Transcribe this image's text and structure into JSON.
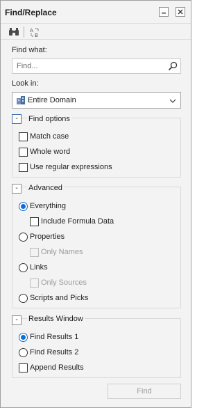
{
  "window": {
    "title": "Find/Replace"
  },
  "find_what": {
    "label": "Find what:",
    "placeholder": "Find..."
  },
  "look_in": {
    "label": "Look in:",
    "value": "Entire Domain"
  },
  "find_options": {
    "title": "Find options",
    "items": [
      {
        "label": "Match case"
      },
      {
        "label": "Whole word"
      },
      {
        "label": "Use regular expressions"
      }
    ]
  },
  "advanced": {
    "title": "Advanced",
    "everything": "Everything",
    "include_formula": "Include Formula Data",
    "properties": "Properties",
    "only_names": "Only Names",
    "links": "Links",
    "only_sources": "Only Sources",
    "scripts": "Scripts and Picks"
  },
  "results_window": {
    "title": "Results Window",
    "find_results_1": "Find Results 1",
    "find_results_2": "Find Results 2",
    "append_results": "Append Results"
  },
  "actions": {
    "find_label": "Find"
  },
  "colors": {
    "accent": "#0f6ed2",
    "group_border": "#dadada",
    "background": "#f3f3f3"
  }
}
